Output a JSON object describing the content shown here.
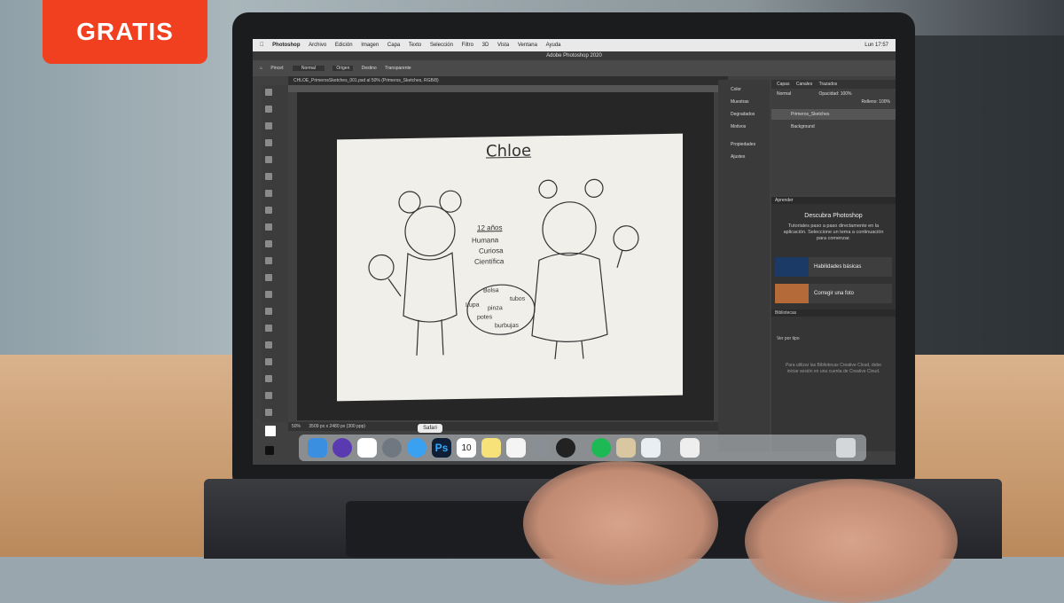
{
  "badge": {
    "label": "GRATIS",
    "color": "#f0401f"
  },
  "menubar": {
    "app": "Photoshop",
    "items": [
      "Archivo",
      "Edición",
      "Imagen",
      "Capa",
      "Texto",
      "Selección",
      "Filtro",
      "3D",
      "Vista",
      "Ventana",
      "Ayuda"
    ],
    "clock": "Lun 17:57"
  },
  "photoshop": {
    "window_title": "Adobe Photoshop 2020",
    "options": {
      "brush_label": "Pincel:",
      "mode": "Normal",
      "origin_button": "Origen",
      "destination_button": "Destino",
      "transparent_label": "Transparente"
    },
    "document_tab": "CHLOE_PrimerosSketches_001.psd al 50% (Primeros_Sketches, RGB/8)",
    "status": {
      "zoom": "50%",
      "size": "3509 px x 2480 px (300 ppp)"
    },
    "mini_panels": [
      "Color",
      "Muestras",
      "Degradados",
      "Motivos",
      "Propiedades",
      "Ajustes"
    ],
    "layers_panel": {
      "tabs": [
        "Capas",
        "Canales",
        "Trazados"
      ],
      "blend_mode": "Normal",
      "opacity_label": "Opacidad:",
      "opacity_value": "100%",
      "fill_label": "Relleno:",
      "fill_value": "100%",
      "layers": [
        "Primeros_Sketches",
        "Background"
      ]
    },
    "learn_panel": {
      "tab": "Aprender",
      "title": "Descubra Photoshop",
      "description": "Tutoriales paso a paso directamente en la aplicación. Seleccione un tema a continuación para comenzar.",
      "cards": [
        "Habilidades básicas",
        "Corregir una foto"
      ]
    },
    "libraries_panel": {
      "tab": "Bibliotecas",
      "view_by": "Ver por tipo",
      "message": "Para utilizar las Bibliotecas Creative Cloud, debe iniciar sesión en una cuenta de Creative Cloud."
    }
  },
  "sketch": {
    "title": "Chloe",
    "notes": [
      "12 años",
      "Humana",
      "Curiosa",
      "Científica"
    ],
    "bag_notes": [
      "Bolsa",
      "tubos",
      "Lupa",
      "pinza",
      "potes",
      "burbujas"
    ]
  },
  "dock": {
    "tooltip": "Safari",
    "icons": [
      "finder-icon",
      "siri-icon",
      "slack-icon",
      "launchpad-icon",
      "safari-icon",
      "photoshop-icon",
      "calendar-icon",
      "notes-icon",
      "reminders-icon",
      "system-preferences-icon",
      "davinci-icon",
      "spotify-icon",
      "itunes-icon",
      "preview-icon",
      "music-icon",
      "trash-icon"
    ],
    "calendar_day": "10"
  }
}
